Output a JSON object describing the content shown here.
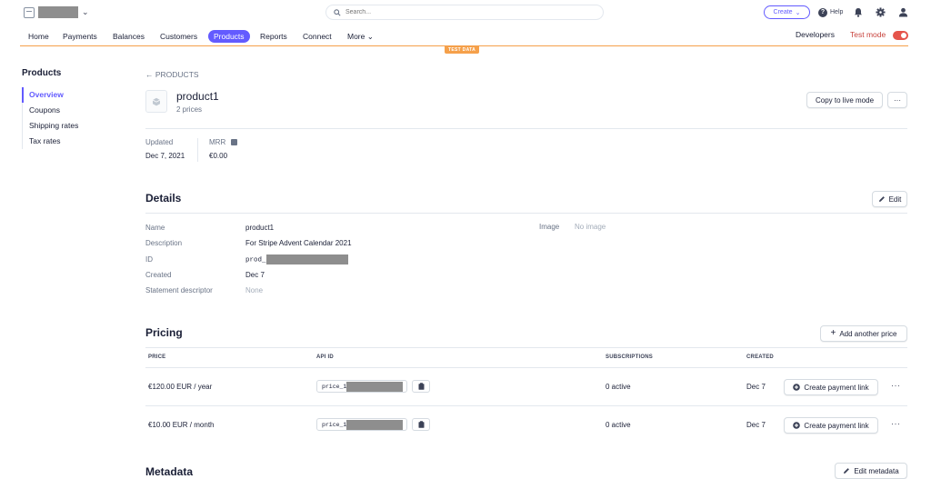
{
  "topbar": {
    "search_placeholder": "Search...",
    "create_label": "Create",
    "help_label": "Help"
  },
  "nav": {
    "items": [
      "Home",
      "Payments",
      "Balances",
      "Customers",
      "Products",
      "Reports",
      "Connect",
      "More"
    ],
    "active": "Products",
    "developers_label": "Developers",
    "test_mode_label": "Test mode",
    "test_data_badge": "TEST DATA",
    "test_mode_on": true,
    "accent_color": "#635bff",
    "test_color": "#f5a04a"
  },
  "sidebar": {
    "title": "Products",
    "items": [
      "Overview",
      "Coupons",
      "Shipping rates",
      "Tax rates"
    ],
    "active": "Overview"
  },
  "product": {
    "breadcrumb": "← PRODUCTS",
    "name": "product1",
    "prices_count": "2 prices",
    "copy_live_label": "Copy to live mode",
    "more_label": "···",
    "updated_label": "Updated",
    "updated_value": "Dec 7, 2021",
    "mrr_label": "MRR",
    "mrr_value": "€0.00"
  },
  "details": {
    "title": "Details",
    "edit_label": "Edit",
    "name_label": "Name",
    "name_value": "product1",
    "description_label": "Description",
    "description_value": "For Stripe Advent Calendar 2021",
    "id_label": "ID",
    "id_value": "prod_",
    "created_label": "Created",
    "created_value": "Dec 7",
    "statement_label": "Statement descriptor",
    "statement_value": "None",
    "image_label": "Image",
    "image_value": "No image"
  },
  "pricing": {
    "title": "Pricing",
    "add_price_label": "Add another price",
    "columns": [
      "PRICE",
      "API ID",
      "SUBSCRIPTIONS",
      "CREATED"
    ],
    "rows": [
      {
        "price": "€120.00 EUR / year",
        "api_id": "price_1",
        "subscriptions": "0 active",
        "created": "Dec 7",
        "link_label": "Create payment link",
        "more": "···"
      },
      {
        "price": "€10.00 EUR / month",
        "api_id": "price_1",
        "subscriptions": "0 active",
        "created": "Dec 7",
        "link_label": "Create payment link",
        "more": "···"
      }
    ]
  },
  "metadata": {
    "title": "Metadata",
    "edit_label": "Edit metadata"
  }
}
